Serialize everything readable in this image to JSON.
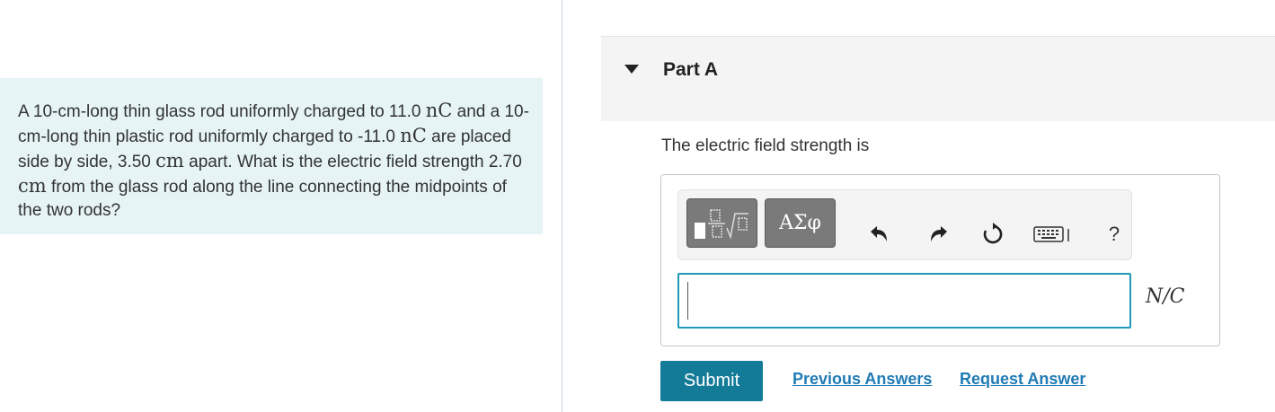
{
  "problem": {
    "segments": [
      {
        "t": "A 10-cm-long thin glass rod uniformly charged to 11.0 ",
        "m": false
      },
      {
        "t": "nC",
        "m": true
      },
      {
        "t": " and a 10-cm-long thin plastic rod uniformly charged to -11.0 ",
        "m": false
      },
      {
        "t": "nC",
        "m": true
      },
      {
        "t": " are placed side by side, 3.50 ",
        "m": false
      },
      {
        "t": "cm",
        "m": true
      },
      {
        "t": " apart. What is the electric field strength 2.70 ",
        "m": false
      },
      {
        "t": "cm",
        "m": true
      },
      {
        "t": " from the glass rod along the line connecting the midpoints of the two rods?",
        "m": false
      }
    ]
  },
  "part": {
    "title": "Part A",
    "prompt": "The electric field strength is"
  },
  "toolbar": {
    "greek_label": "ΑΣφ",
    "help_label": "?"
  },
  "answer": {
    "value": "",
    "unit": "N/C"
  },
  "actions": {
    "submit_label": "Submit",
    "previous_answers_label": "Previous Answers",
    "request_answer_label": "Request Answer"
  },
  "colors": {
    "problem_background": "#e6f4f5",
    "submit_background": "#137b98",
    "link": "#1f7bb5",
    "input_border": "#1f9ab6"
  }
}
